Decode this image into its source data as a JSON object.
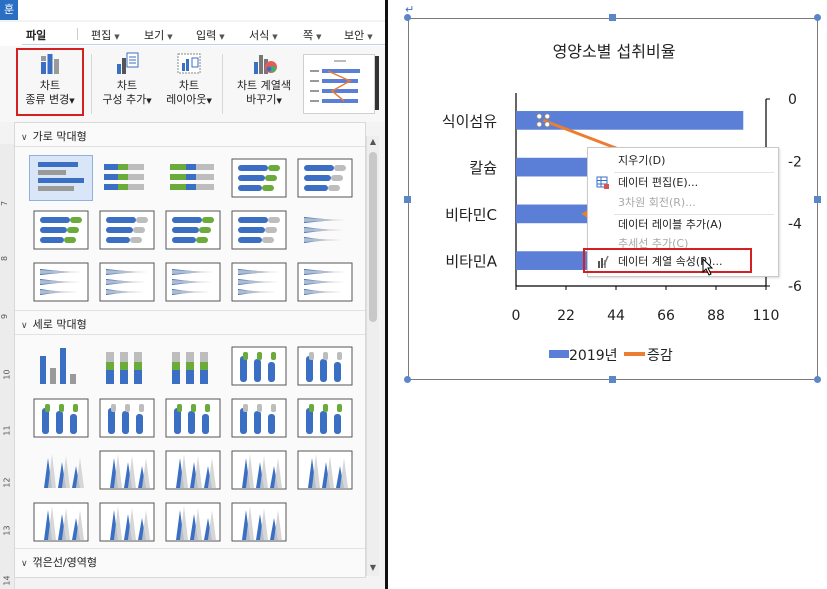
{
  "app": {
    "logo_text": "훈",
    "menu": [
      {
        "label": "파일"
      },
      {
        "label": "편집"
      },
      {
        "label": "보기"
      },
      {
        "label": "입력"
      },
      {
        "label": "서식"
      },
      {
        "label": "쪽"
      },
      {
        "label": "보안"
      }
    ]
  },
  "ribbon": {
    "buttons": [
      {
        "line1": "차트",
        "line2": "종류 변경",
        "selected": true
      },
      {
        "line1": "차트",
        "line2": "구성 추가"
      },
      {
        "line1": "차트",
        "line2": "레이아웃"
      },
      {
        "line1": "차트 계열색",
        "line2": "바꾸기"
      }
    ]
  },
  "gallery": {
    "sections": [
      {
        "title": "가로 막대형"
      },
      {
        "title": "세로 막대형"
      },
      {
        "title": "꺾은선/영역형"
      }
    ],
    "ruler_numbers": [
      "7",
      "8",
      "9",
      "10",
      "11",
      "12",
      "13",
      "14"
    ]
  },
  "context_menu": {
    "items": [
      {
        "label": "지우기(D)",
        "enabled": true
      },
      {
        "label": "데이터 편집(E)...",
        "enabled": true
      },
      {
        "label": "3차원 회전(R)...",
        "enabled": false
      },
      {
        "label": "데이터 레이블 추가(A)",
        "enabled": true
      },
      {
        "label": "추세선 추가(C)",
        "enabled": false
      },
      {
        "label": "데이터 계열 속성(R)...",
        "enabled": true,
        "highlighted": true
      }
    ]
  },
  "chart_data": {
    "type": "bar",
    "orientation": "horizontal",
    "title": "영양소별 섭취비율",
    "categories": [
      "식이섬유",
      "칼슘",
      "비타민C",
      "비타민A"
    ],
    "x_ticks": [
      "0",
      "22",
      "44",
      "66",
      "88",
      "110"
    ],
    "xlim": [
      0,
      110
    ],
    "secondary_ticks": [
      "0",
      "-2",
      "-4",
      "-6"
    ],
    "secondary_lim": [
      0,
      -6
    ],
    "series": [
      {
        "name": "2019년",
        "type": "bar",
        "color": "#5b7fd6",
        "values": [
          100,
          95,
          95,
          95
        ]
      },
      {
        "name": "증감",
        "type": "line",
        "color": "#ed7d31",
        "values": [
          -0.7,
          -0.2,
          -0.9,
          -0.4
        ]
      }
    ],
    "legend_position": "bottom"
  }
}
